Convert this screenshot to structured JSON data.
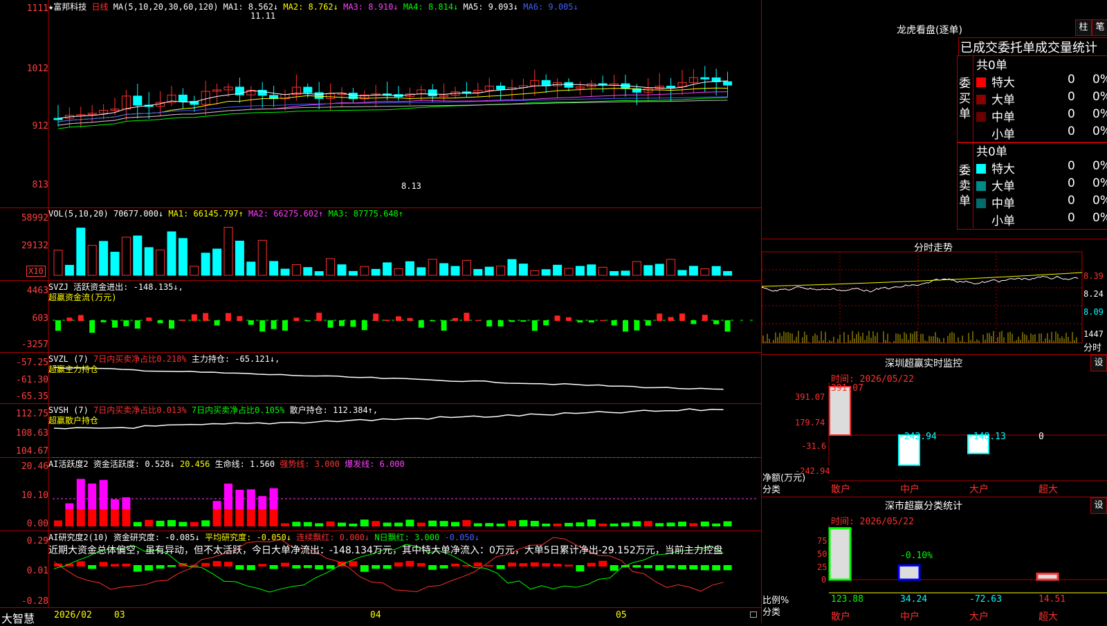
{
  "header": {
    "stock": "★富邦科技",
    "period": "日线",
    "ma_label": "MA(5,10,20,30,60,120)",
    "ma": [
      "MA1: 8.562↓",
      "MA2: 8.762↓",
      "MA3: 8.910↓",
      "MA4: 8.814↓",
      "MA5: 9.093↓",
      "MA6: 9.005↓"
    ],
    "hi_note": "11.11",
    "lo_note": "8.13"
  },
  "kline_axis": [
    "1111",
    "1012",
    "912",
    "813"
  ],
  "vol": {
    "label": "VOL(5,10,20)",
    "val": "70677.000↓",
    "ma1": "MA1: 66145.797↑",
    "ma2": "MA2: 66275.602↑",
    "ma3": "MA3: 87775.648↑",
    "axis": [
      "58992",
      "29132"
    ],
    "unit": "X10"
  },
  "svzj": {
    "label": "SVZJ",
    "text": "活跃资金进出: -148.135↓,",
    "sub": "超赢资金流(万元)",
    "axis": [
      "4463",
      "603",
      "-3257"
    ]
  },
  "svzl": {
    "label": "SVZL (7)",
    "t1": "7日内买卖净占比0.218%",
    "t2": "主力持仓: -65.121↓,",
    "sub": "超赢主力持仓",
    "axis": [
      "-57.25",
      "-61.30",
      "-65.35"
    ]
  },
  "svsh": {
    "label": "SVSH (7)",
    "t1": "7日内买卖净占比0.013%",
    "t2": "7日内买卖净占比0.105%",
    "t3": "散户持仓: 112.384↑,",
    "sub": "超赢散户持仓",
    "axis": [
      "112.75",
      "108.63",
      "104.67"
    ]
  },
  "ai1": {
    "label": "AI活跃度2",
    "t1": "资金活跃度: 0.528↓",
    "t2": "20.456",
    "t3": "生命线: 1.560",
    "t4": "强势线: 3.000",
    "t5": "爆发线: 6.000",
    "axis": [
      "20.46",
      "10.10",
      "0.00"
    ]
  },
  "ai2": {
    "label": "AI研究度2(10)",
    "t1": "资金研究度: -0.085↓",
    "t2": "平均研究度: -0.050↓",
    "t3": "连续飘红: 0.000↓",
    "t4": "N日飘红: 3.000",
    "t5": "-0.050↓",
    "comment": "近期大资金总体偏空，虽有异动，但不太活跃，今日大单净流出：-148.134万元，其中特大单净流入：0万元，大单5日累计净出-29.152万元，当前主力控盘",
    "axis": [
      "0.29",
      "0.01",
      "-0.28"
    ]
  },
  "footer": {
    "brand": "大智慧",
    "dates": [
      "2026/02",
      "03",
      "04",
      "05"
    ]
  },
  "dragon": {
    "title": "龙虎看盘(逐单)",
    "btn1": "柱",
    "btn2": "笔",
    "head": "已成交委托单成交量统计",
    "buy_label": "委买单",
    "sell_label": "委卖单",
    "buy_total": "共0单",
    "sell_total": "共0单",
    "buy_rows": [
      {
        "name": "特大",
        "n": "0",
        "p": "0%",
        "c": "#ff0000"
      },
      {
        "name": "大单",
        "n": "0",
        "p": "0%",
        "c": "#8b0000"
      },
      {
        "name": "中单",
        "n": "0",
        "p": "0%",
        "c": "#6b0000"
      },
      {
        "name": "小单",
        "n": "0",
        "p": "0%",
        "c": "#000000"
      }
    ],
    "sell_rows": [
      {
        "name": "特大",
        "n": "0",
        "p": "0%",
        "c": "#00ffff"
      },
      {
        "name": "大单",
        "n": "0",
        "p": "0%",
        "c": "#008b8b"
      },
      {
        "name": "中单",
        "n": "0",
        "p": "0%",
        "c": "#006b6b"
      },
      {
        "name": "小单",
        "n": "0",
        "p": "0%",
        "c": "#000000"
      }
    ]
  },
  "intraday": {
    "title": "分时走势",
    "axis": [
      "8.39",
      "8.24",
      "8.09"
    ],
    "vol_axis": "1447",
    "vol_unit": "分时"
  },
  "sz_monitor": {
    "title": "深圳超赢实时监控",
    "btn": "设",
    "time": "时间: 2026/05/22",
    "axis": [
      "391.07",
      "179.74",
      "-31.6",
      "-242.94"
    ],
    "ylabel": "净额(万元)",
    "xlabel": "分类",
    "cats": [
      "散户",
      "中户",
      "大户",
      "超大"
    ],
    "values": [
      "391.07",
      "-242.94",
      "-148.13",
      "0"
    ],
    "vals_num": [
      391.07,
      -242.94,
      -148.13,
      0
    ]
  },
  "sz_class": {
    "title": "深市超赢分类统计",
    "btn": "设",
    "time": "时间: 2026/05/22",
    "axis": [
      "75",
      "50",
      "25",
      "0"
    ],
    "ylabel": "比例%",
    "xlabel": "分类",
    "cats": [
      "散户",
      "中户",
      "大户",
      "超大"
    ],
    "values": [
      "123.88",
      "34.24",
      "-72.63",
      "14.51"
    ],
    "mid_label": "-0.10%",
    "vals_num": [
      123.88,
      34.24,
      -72.63,
      14.51
    ]
  }
}
